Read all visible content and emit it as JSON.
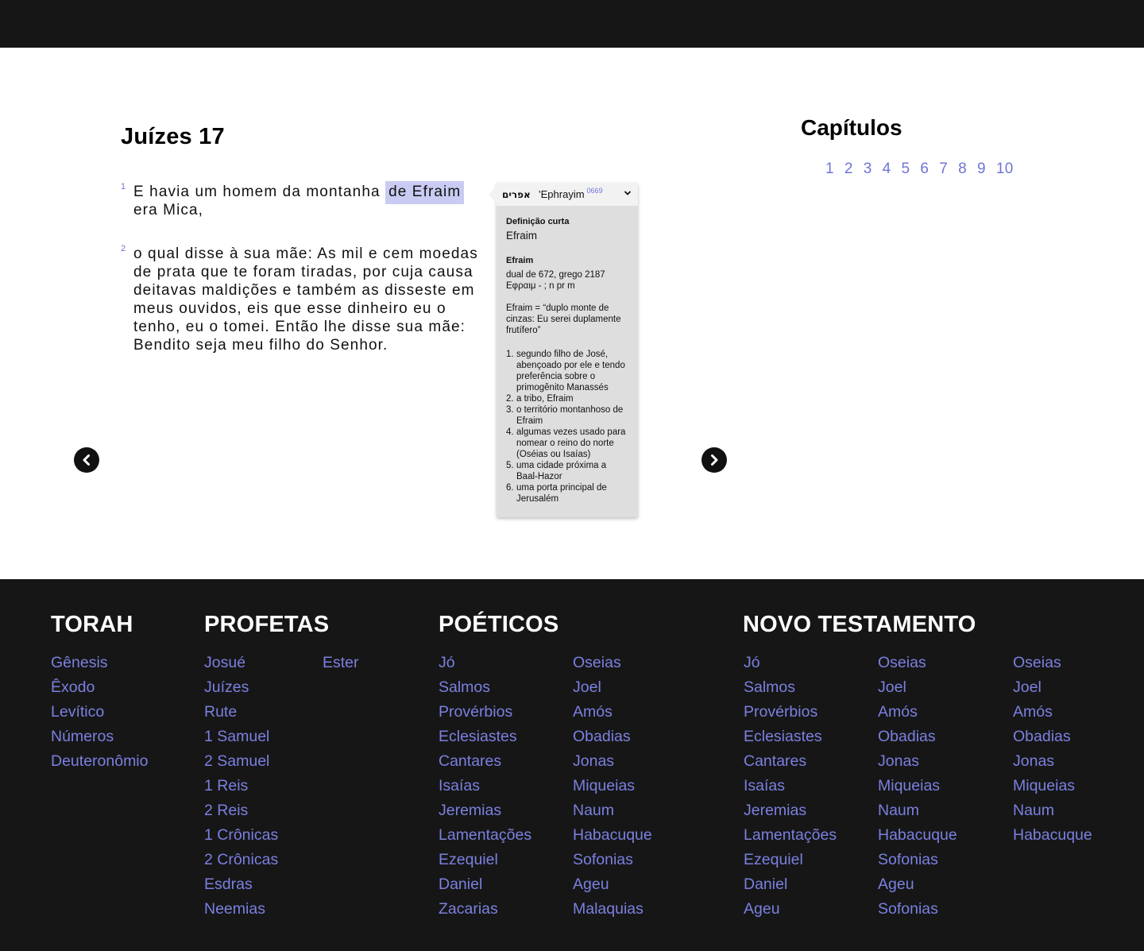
{
  "chapter": {
    "title": "Juízes 17",
    "verses": [
      {
        "num": "1",
        "before": "E havia um homem da montanha",
        "highlight": "de Efraim",
        "after": "era Mica,"
      },
      {
        "num": "2",
        "text": "o qual disse à sua mãe: As mil e cem moedas de prata que te foram tiradas, por cuja causa deitavas maldições e também as disseste em meus ouvidos, eis que esse dinheiro eu o tenho, eu o tomei. Então lhe disse sua mãe: Bendito seja meu filho do Senhor."
      }
    ]
  },
  "popup": {
    "hebrew": "אפרים",
    "transliteration": "’Ephrayim",
    "strong": "0669",
    "short_label": "Definição curta",
    "short_value": "Efraim",
    "entry_label": "Efraim",
    "lines1": [
      "dual de 672, grego 2187",
      "Εφραιμ - ; n pr m"
    ],
    "lines2": [
      "Efraim = “duplo monte de",
      "cinzas: Eu serei duplamente",
      "frutífero”"
    ],
    "definitions": [
      {
        "n": "1.",
        "lines": [
          "segundo filho de José,",
          "abençoado por ele e tendo",
          "preferência sobre o",
          "primogênito Manassés"
        ]
      },
      {
        "n": "2.",
        "lines": [
          "a tribo, Efraim"
        ]
      },
      {
        "n": "3.",
        "lines": [
          "o território montanhoso de",
          "Efraim"
        ]
      },
      {
        "n": "4.",
        "lines": [
          "algumas vezes usado para",
          "nomear o reino do norte",
          "(Oséias ou Isaías)"
        ]
      },
      {
        "n": "5.",
        "lines": [
          "uma cidade próxima a",
          "Baal-Hazor"
        ]
      },
      {
        "n": "6.",
        "lines": [
          "uma porta principal de",
          "Jerusalém"
        ]
      }
    ]
  },
  "navigation": {
    "prev_icon": "chevron-left-icon",
    "next_icon": "chevron-right-icon"
  },
  "chapters": {
    "title": "Capítulos",
    "items": [
      "1",
      "2",
      "3",
      "4",
      "5",
      "6",
      "7",
      "8",
      "9",
      "10"
    ]
  },
  "footer": {
    "torah": {
      "title": "TORAH",
      "books": [
        "Gênesis",
        "Êxodo",
        "Levítico",
        "Números",
        "Deuteronômio"
      ]
    },
    "profetas": {
      "title": "PROFETAS",
      "col1": [
        "Josué",
        "Juízes",
        "Rute",
        "1 Samuel",
        "2 Samuel",
        "1 Reis",
        "2 Reis",
        "1 Crônicas",
        "2 Crônicas",
        "Esdras",
        "Neemias"
      ],
      "col2": [
        "Ester"
      ]
    },
    "poeticos": {
      "title": "POÉTICOS",
      "col1": [
        "Jó",
        "Salmos",
        "Provérbios",
        "Eclesiastes",
        "Cantares",
        "Isaías",
        "Jeremias",
        "Lamentações",
        "Ezequiel",
        "Daniel",
        "Zacarias"
      ],
      "col2": [
        "Oseias",
        "Joel",
        "Amós",
        "Obadias",
        "Jonas",
        "Miqueias",
        "Naum",
        "Habacuque",
        "Sofonias",
        "Ageu",
        "Malaquias"
      ]
    },
    "novo": {
      "title": "NOVO TESTAMENTO",
      "col1": [
        "Jó",
        "Salmos",
        "Provérbios",
        "Eclesiastes",
        "Cantares",
        "Isaías",
        "Jeremias",
        "Lamentações",
        "Ezequiel",
        "Daniel",
        "Ageu"
      ],
      "col2": [
        "Oseias",
        "Joel",
        "Amós",
        "Obadias",
        "Jonas",
        "Miqueias",
        "Naum",
        "Habacuque",
        "Sofonias",
        "Ageu",
        "Sofonias"
      ],
      "col3": [
        "Oseias",
        "Joel",
        "Amós",
        "Obadias",
        "Jonas",
        "Miqueias",
        "Naum",
        "Habacuque"
      ]
    }
  },
  "colors": {
    "accent": "#6f74d6",
    "highlight": "#c9cbf2",
    "dark": "#161616",
    "popup_bg": "#dedede"
  }
}
